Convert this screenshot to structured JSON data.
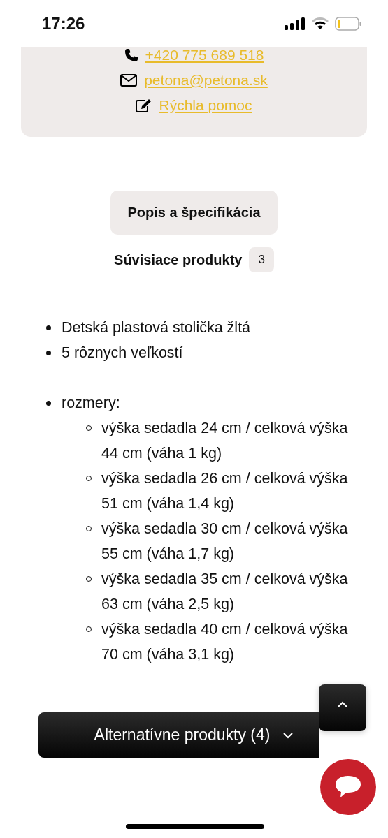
{
  "status_bar": {
    "time": "17:26"
  },
  "contacts": [
    {
      "kind": "phone",
      "text": "+420 775 689 518"
    },
    {
      "kind": "email",
      "text": "petona@petona.sk"
    },
    {
      "kind": "edit",
      "text": "Rýchla pomoc"
    }
  ],
  "tabs": [
    {
      "label": "Popis a špecifikácia",
      "selected": true
    },
    {
      "label": "Súvisiace produkty",
      "count": "3",
      "selected": false
    }
  ],
  "description": {
    "items": [
      {
        "text": "Detská plastová stolička žltá"
      },
      {
        "text": "5 rôznych veľkostí"
      }
    ],
    "dimensions": {
      "text": "rozmery:",
      "children": [
        {
          "text": "výška sedadla 24 cm / celková výška 44 cm (váha 1 kg)"
        },
        {
          "text": "výška sedadla 26 cm / celková výška 51 cm (váha 1,4 kg)"
        },
        {
          "text": "výška sedadla 30 cm / celková výška 55 cm (váha 1,7 kg)"
        },
        {
          "text": "výška sedadla 35 cm / celková výška 63 cm (váha 2,5 kg)"
        },
        {
          "text": "výška sedadla 40 cm / celková výška 70 cm (váha 3,1 kg)"
        }
      ]
    }
  },
  "alternatives_button": {
    "label": "Alternatívne produkty (4)"
  }
}
